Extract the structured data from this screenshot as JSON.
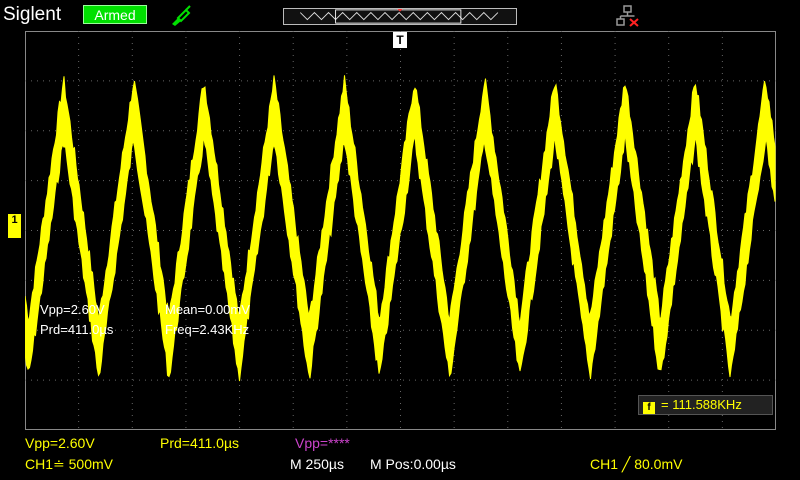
{
  "header": {
    "brand": "Siglent",
    "status": "Armed",
    "icons": {
      "probe": "probe-icon",
      "network": "network-disconnected-icon"
    }
  },
  "screen": {
    "trigger_marker": "T",
    "ch1_marker": "1",
    "measurements_overlay": {
      "vpp": "Vpp=2.60V",
      "prd": "Prd=411.0µs",
      "mean": "Mean=0.00mV",
      "freq": "Freq=2.43KHz"
    },
    "frequency_counter": "= 111.588KHz",
    "waveform": {
      "color": "#ffff00",
      "cycles_visible": 10.7
    }
  },
  "bottom_bar": {
    "meas1": "Vpp=2.60V",
    "meas2": "Prd=411.0µs",
    "meas3": "Vpp=****",
    "ch1_scale": "CH1≐ 500mV",
    "timebase": "M 250µs",
    "mpos": "M Pos:0.00µs",
    "trigger": "CH1 ╱ 80.0mV"
  },
  "colors": {
    "ch1": "#ffff00",
    "math": "#cc44cc",
    "status": "#00e000"
  }
}
